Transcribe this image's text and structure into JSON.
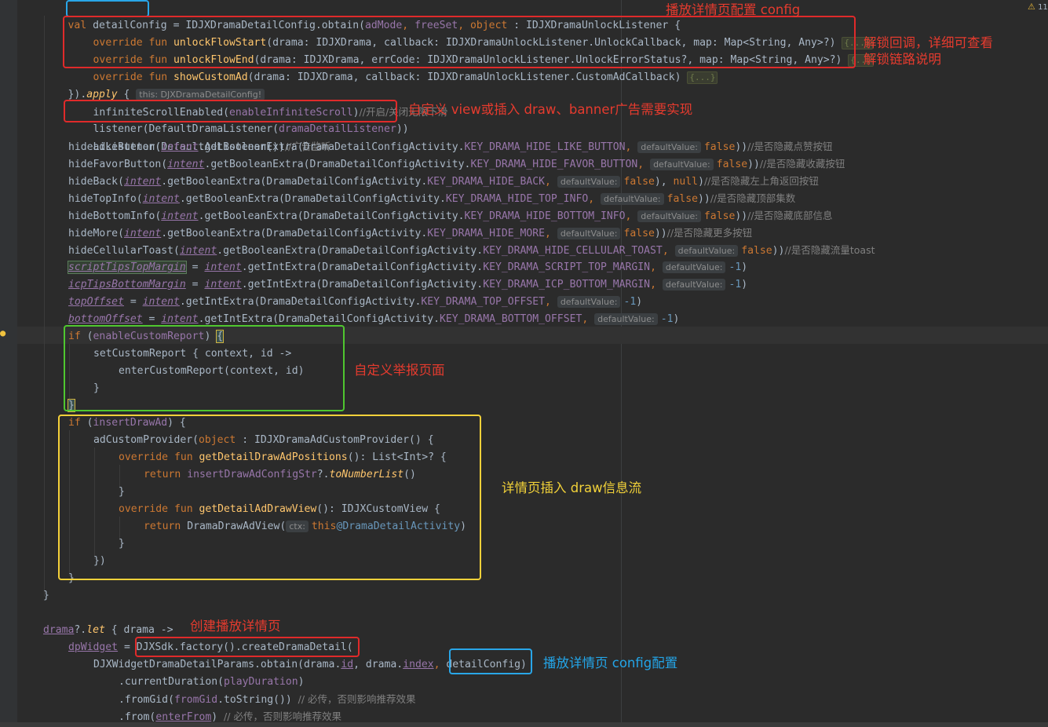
{
  "status": {
    "warning_count": "11"
  },
  "annotations": {
    "config": "播放详情页配置 config",
    "unlock_1": "解锁回调，详细可查看",
    "unlock_2": "解锁链路说明",
    "listener": "自定义 view或插入 draw、banner广告需要实现",
    "report": "自定义举报页面",
    "draw": "详情页插入 draw信息流",
    "create": "创建播放详情页",
    "detail_config": "播放详情页 config配置"
  },
  "code": {
    "l1": {
      "val": "val ",
      "var": "detailConfig",
      "eq": " = IDJXDramaDetailConfig.obtain(",
      "p1": "adMode",
      "c1": ", ",
      "p2": "freeSet",
      "c2": ", ",
      "obj": "object",
      "rest": " : IDJXDramaUnlockListener {"
    },
    "l2": {
      "kw": "override fun ",
      "fn": "unlockFlowStart",
      "sig": "(drama: IDJXDrama, callback: IDJXDramaUnlockListener.UnlockCallback, map: Map<String, Any>?) ",
      "fold": "{...}"
    },
    "l3": {
      "kw": "override fun ",
      "fn": "unlockFlowEnd",
      "sig": "(drama: IDJXDrama, errCode: IDJXDramaUnlockListener.UnlockErrorStatus?, map: Map<String, Any>?) ",
      "fold": "{..."
    },
    "l4": {
      "kw": "override fun ",
      "fn": "showCustomAd",
      "sig": "(drama: IDJXDrama, callback: IDJXDramaUnlockListener.CustomAdCallback) ",
      "fold": "{...}"
    },
    "l5": {
      "pre": "}).",
      "apply": "apply",
      "brace": " { ",
      "hint": "this: DJXDramaDetailConfig!"
    },
    "l6": {
      "fn": "infiniteScrollEnabled(",
      "arg": "enableInfiniteScroll",
      "close": ")",
      "cmt": "//开启/关闭无限下滑"
    },
    "l7": {
      "pre": "listener(DefaultDramaListener(",
      "arg": "dramaDetailListener",
      "close": "))"
    },
    "l8": {
      "pre": "adListener(DefaultAdListener())",
      "cmt": "//广告监听"
    },
    "rows": [
      {
        "fn": "hideLikeButton(",
        "intent": "intent",
        "mid": ".getBooleanExtra(DramaDetailConfigActivity.",
        "key": "KEY_DRAMA_HIDE_LIKE_BUTTON",
        "hint": "defaultValue:",
        "val": "false",
        "close": "))",
        "cmt": "//是否隐藏点赞按钮"
      },
      {
        "fn": "hideFavorButton(",
        "intent": "intent",
        "mid": ".getBooleanExtra(DramaDetailConfigActivity.",
        "key": "KEY_DRAMA_HIDE_FAVOR_BUTTON",
        "hint": "defaultValue:",
        "val": "false",
        "close": "))",
        "cmt": "//是否隐藏收藏按钮"
      },
      {
        "fn": "hideBack(",
        "intent": "intent",
        "mid": ".getBooleanExtra(DramaDetailConfigActivity.",
        "key": "KEY_DRAMA_HIDE_BACK",
        "hint": "defaultValue:",
        "val": "false",
        "close": "), ",
        "extra": "null",
        "close2": ")",
        "cmt": "//是否隐藏左上角返回按钮"
      },
      {
        "fn": "hideTopInfo(",
        "intent": "intent",
        "mid": ".getBooleanExtra(DramaDetailConfigActivity.",
        "key": "KEY_DRAMA_HIDE_TOP_INFO",
        "hint": "defaultValue:",
        "val": "false",
        "close": "))",
        "cmt": "//是否隐藏顶部集数"
      },
      {
        "fn": "hideBottomInfo(",
        "intent": "intent",
        "mid": ".getBooleanExtra(DramaDetailConfigActivity.",
        "key": "KEY_DRAMA_HIDE_BOTTOM_INFO",
        "hint": "defaultValue:",
        "val": "false",
        "close": "))",
        "cmt": "//是否隐藏底部信息"
      },
      {
        "fn": "hideMore(",
        "intent": "intent",
        "mid": ".getBooleanExtra(DramaDetailConfigActivity.",
        "key": "KEY_DRAMA_HIDE_MORE",
        "hint": "defaultValue:",
        "val": "false",
        "close": "))",
        "cmt": "//是否隐藏更多按钮"
      },
      {
        "fn": "hideCellularToast(",
        "intent": "intent",
        "mid": ".getBooleanExtra(DramaDetailConfigActivity.",
        "key": "KEY_DRAMA_HIDE_CELLULAR_TOAST",
        "hint": "defaultValue:",
        "val": "false",
        "close": "))",
        "cmt": "//是否隐藏流量toast"
      }
    ],
    "assigns": [
      {
        "lhs": "scriptTipsTopMargin",
        "eq": " = ",
        "intent": "intent",
        "mid": ".getIntExtra(DramaDetailConfigActivity.",
        "key": "KEY_DRAMA_SCRIPT_TOP_MARGIN",
        "hint": "defaultValue:",
        "val": "-1",
        "close": ")"
      },
      {
        "lhs": "icpTipsBottomMargin",
        "eq": " = ",
        "intent": "intent",
        "mid": ".getIntExtra(DramaDetailConfigActivity.",
        "key": "KEY_DRAMA_ICP_BOTTOM_MARGIN",
        "hint": "defaultValue:",
        "val": "-1",
        "close": ")"
      },
      {
        "lhs": "topOffset",
        "eq": " = ",
        "intent": "intent",
        "mid": ".getIntExtra(DramaDetailConfigActivity.",
        "key": "KEY_DRAMA_TOP_OFFSET",
        "hint": "defaultValue:",
        "val": "-1",
        "close": ")"
      },
      {
        "lhs": "bottomOffset",
        "eq": " = ",
        "intent": "intent",
        "mid": ".getIntExtra(DramaDetailConfigActivity.",
        "key": "KEY_DRAMA_BOTTOM_OFFSET",
        "hint": "defaultValue:",
        "val": "-1",
        "close": ")"
      }
    ],
    "report": {
      "if_kw": "if ",
      "if_cond_open": "(",
      "if_var": "enableCustomReport",
      "if_cond_close": ") ",
      "if_brace": "{",
      "l2": "setCustomReport { context, id ->",
      "l3": "enterCustomReport(context, id)",
      "l4": "}",
      "l5": "}"
    },
    "draw": {
      "if_kw": "if ",
      "if_open": "(",
      "if_var": "insertDrawAd",
      "if_close": ") {",
      "l2_pre": "adCustomProvider(",
      "l2_obj": "object",
      "l2_rest": " : IDJXDramaAdCustomProvider() {",
      "l3_kw": "override fun ",
      "l3_fn": "getDetailDrawAdPositions",
      "l3_rest": "(): List<Int>? {",
      "l4_kw": "return ",
      "l4_var": "insertDrawAdConfigStr",
      "l4_mid": "?.",
      "l4_fn": "toNumberList",
      "l4_rest": "()",
      "l5": "}",
      "l6_kw": "override fun ",
      "l6_fn": "getDetailAdDrawView",
      "l6_rest": "(): IDJXCustomView {",
      "l7_kw": "return ",
      "l7_pre": "DramaDrawAdView(",
      "l7_hint": "ctx:",
      "l7_this": "this",
      "l7_label": "@DramaDetailActivity",
      "l7_close": ")",
      "l8": "}",
      "l9": "})",
      "l10": "}"
    },
    "close_brace": "}",
    "tail": {
      "l1_var": "drama",
      "l1_mid": "?.",
      "l1_let": "let",
      "l1_rest": " { drama ->",
      "l2_var": "dpWidget",
      "l2_eq": " = ",
      "l2_call": "DJXSdk.factory().createDramaDetail(",
      "l3_pre": "DJXWidgetDramaDetailParams.obtain(drama.",
      "l3_id": "id",
      "l3_c": ", drama.",
      "l3_index": "index",
      "l3_c2": ", ",
      "l3_cfg": "detailConfig",
      "l3_close": ")",
      "l4_pre": ".currentDuration(",
      "l4_var": "playDuration",
      "l4_close": ")",
      "l5_pre": ".fromGid(",
      "l5_var": "fromGid",
      "l5_mid": ".toString()) ",
      "l5_cmt": "// 必传，否则影响推荐效果",
      "l6_pre": ".from(",
      "l6_var": "enterFrom",
      "l6_mid": ") ",
      "l6_cmt": "// 必传，否则影响推荐效果"
    }
  }
}
